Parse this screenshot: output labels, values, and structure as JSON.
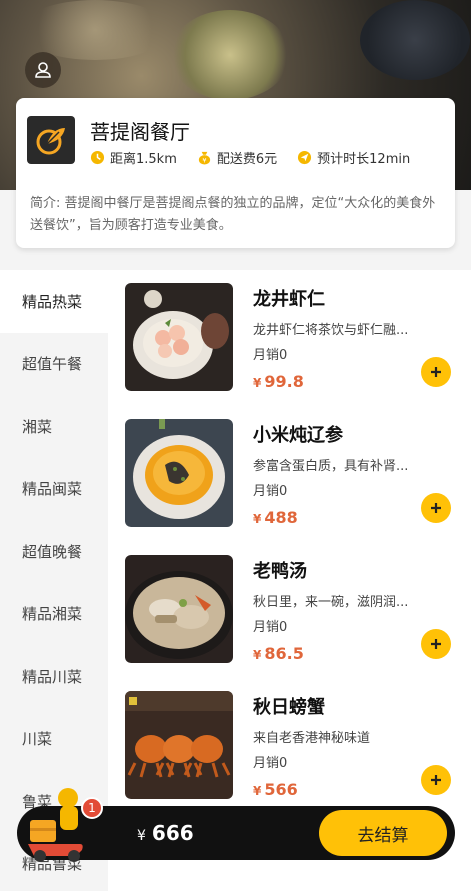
{
  "shop": {
    "name": "菩提阁餐厅",
    "distance": "距离1.5km",
    "delivery_fee": "配送费6元",
    "eta": "预计时长12min",
    "description": "简介: 菩提阁中餐厅是菩提阁点餐的独立的品牌，定位“大众化的美食外送餐饮”，旨为顾客打造专业美食。"
  },
  "categories": [
    "精品热菜",
    "超值午餐",
    "湘菜",
    "精品闽菜",
    "超值晚餐",
    "精品湘菜",
    "精品川菜",
    "川菜",
    "鲁菜",
    "精品鲁菜"
  ],
  "dishes": [
    {
      "name": "龙井虾仁",
      "desc": "龙井虾仁将茶饮与虾仁融...",
      "sales": "月销0",
      "currency": "¥",
      "price": "99.8"
    },
    {
      "name": "小米炖辽参",
      "desc": "参富含蛋白质，具有补肾...",
      "sales": "月销0",
      "currency": "¥",
      "price": "488"
    },
    {
      "name": "老鸭汤",
      "desc": "秋日里，来一碗，滋阴润...",
      "sales": "月销0",
      "currency": "¥",
      "price": "86.5"
    },
    {
      "name": "秋日螃蟹",
      "desc": "来自老香港神秘味道",
      "sales": "月销0",
      "currency": "¥",
      "price": "566"
    }
  ],
  "cart": {
    "count": "1",
    "currency": "¥",
    "total": "666",
    "checkout_label": "去结算"
  },
  "icons": {
    "user": "user-icon",
    "logo": "leaf-logo-icon",
    "distance": "clock-icon",
    "fee": "money-bag-icon",
    "eta": "navigation-arrow-icon",
    "add": "plus-icon",
    "cart": "delivery-rider-icon"
  },
  "colors": {
    "accent": "#ffc107",
    "price": "#e0663a",
    "badge": "#e24b36",
    "bar": "#111111"
  }
}
